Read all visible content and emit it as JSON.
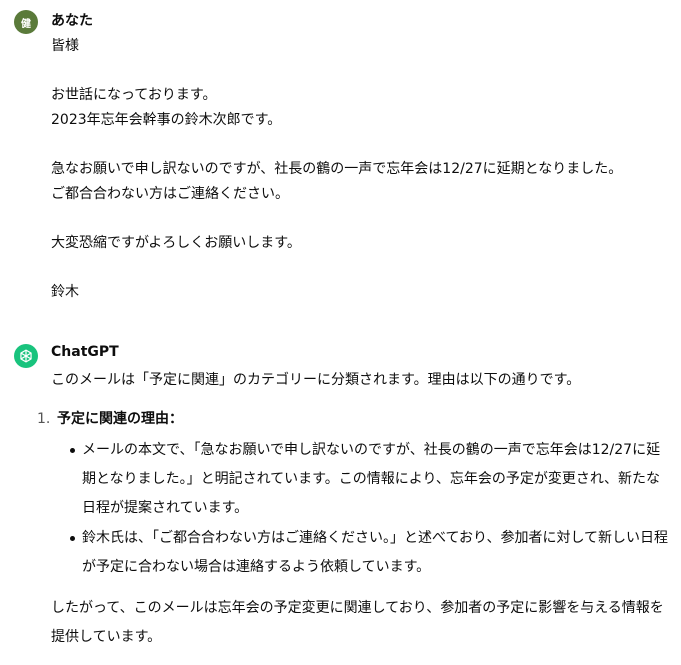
{
  "colors": {
    "user_avatar_bg": "#5a7a3a",
    "bot_avatar_bg": "#19c37d",
    "text": "#0d0d0d"
  },
  "user_message": {
    "avatar_text": "健",
    "author": "あなた",
    "lines": [
      "皆様",
      "",
      "お世話になっております。",
      "2023年忘年会幹事の鈴木次郎です。",
      "",
      "急なお願いで申し訳ないのですが、社長の鶴の一声で忘年会は12/27に延期となりました。",
      "ご都合合わない方はご連絡ください。",
      "",
      "大変恐縮ですがよろしくお願いします。",
      "",
      "鈴木"
    ]
  },
  "bot_message": {
    "avatar_icon": "openai-logo-icon",
    "author": "ChatGPT",
    "intro": "このメールは「予定に関連」のカテゴリーに分類されます。理由は以下の通りです。",
    "list": [
      {
        "number": "1.",
        "title": "予定に関連の理由：",
        "bullets": [
          "メールの本文で、「急なお願いで申し訳ないのですが、社長の鶴の一声で忘年会は12/27に延期となりました。」と明記されています。この情報により、忘年会の予定が変更され、新たな日程が提案されています。",
          "鈴木氏は、「ご都合合わない方はご連絡ください。」と述べており、参加者に対して新しい日程が予定に合わない場合は連絡するよう依頼しています。"
        ]
      }
    ],
    "conclusion": "したがって、このメールは忘年会の予定変更に関連しており、参加者の予定に影響を与える情報を提供しています。"
  }
}
